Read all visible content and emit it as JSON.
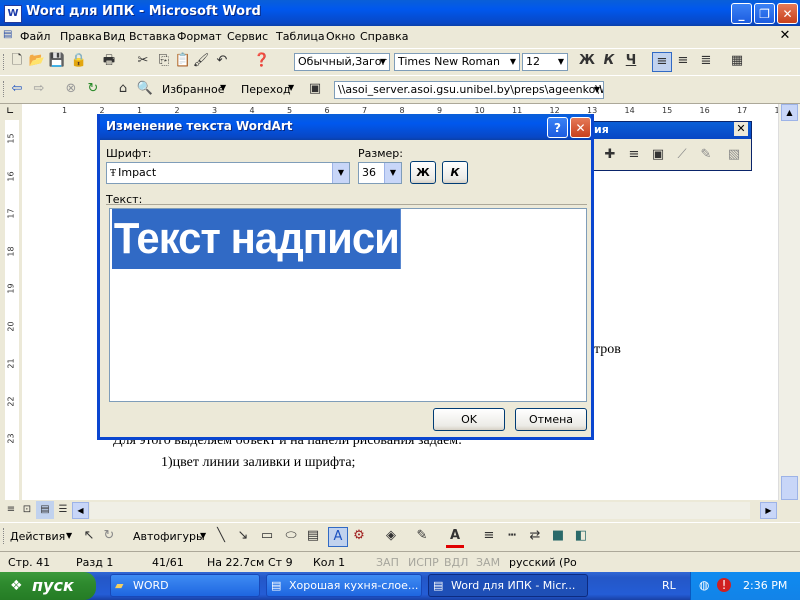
{
  "window": {
    "title": "Word для ИПК - Microsoft Word",
    "app_icon": "W"
  },
  "menu": [
    "Файл",
    "Правка",
    "Вид",
    "Вставка",
    "Формат",
    "Сервис",
    "Таблица",
    "Окно",
    "Справка"
  ],
  "formatting": {
    "style": "Обычный,Загог",
    "font": "Times New Roman",
    "size": "12",
    "bold": "Ж",
    "italic": "К",
    "underline": "Ч"
  },
  "web_toolbar": {
    "favorites": "Избранное",
    "go": "Переход",
    "address": "\\\\asoi_server.asoi.gsu.unibel.by\\preps\\ageenko\\WO"
  },
  "ruler": {
    "h_ticks": [
      "1",
      "2",
      "1",
      "2",
      "3",
      "4",
      "5",
      "6",
      "7",
      "8",
      "9",
      "10",
      "11",
      "12",
      "13",
      "14",
      "15",
      "16",
      "17",
      "18"
    ],
    "v_ticks": [
      "15",
      "16",
      "17",
      "18",
      "19",
      "20",
      "21",
      "22",
      "23"
    ]
  },
  "document": {
    "line_right": "тров",
    "line1": "Для этого выделяем объект и на панели рисования задаем:",
    "line2": "1)цвет линии заливки и шрифта;"
  },
  "dialog": {
    "title": "Изменение текста WordArt",
    "font_label": "Шрифт:",
    "font_value": "Impact",
    "size_label": "Размер:",
    "size_value": "36",
    "bold": "Ж",
    "italic": "К",
    "text_label": "Текст:",
    "text_value": "Текст надписи",
    "ok": "OK",
    "cancel": "Отмена",
    "help": "?",
    "close": "✕"
  },
  "wordart_toolbar": {
    "title_fragment": "ия"
  },
  "drawing": {
    "actions": "Действия",
    "autoshapes": "Автофигуры"
  },
  "status": {
    "page": "Стр. 41",
    "section": "Разд 1",
    "pages": "41/61",
    "at": "На 22.7см",
    "line": "Ст 9",
    "col": "Кол 1",
    "rec": "ЗАП",
    "trk": "ИСПР",
    "ext": "ВДЛ",
    "ovr": "ЗАМ",
    "lang": "русский (Ро"
  },
  "taskbar": {
    "start": "пуск",
    "tasks": [
      "WORD",
      "Хорошая кухня-слое...",
      "Word для ИПК - Micr..."
    ],
    "lang": "RL",
    "time": "2:36 PM"
  }
}
